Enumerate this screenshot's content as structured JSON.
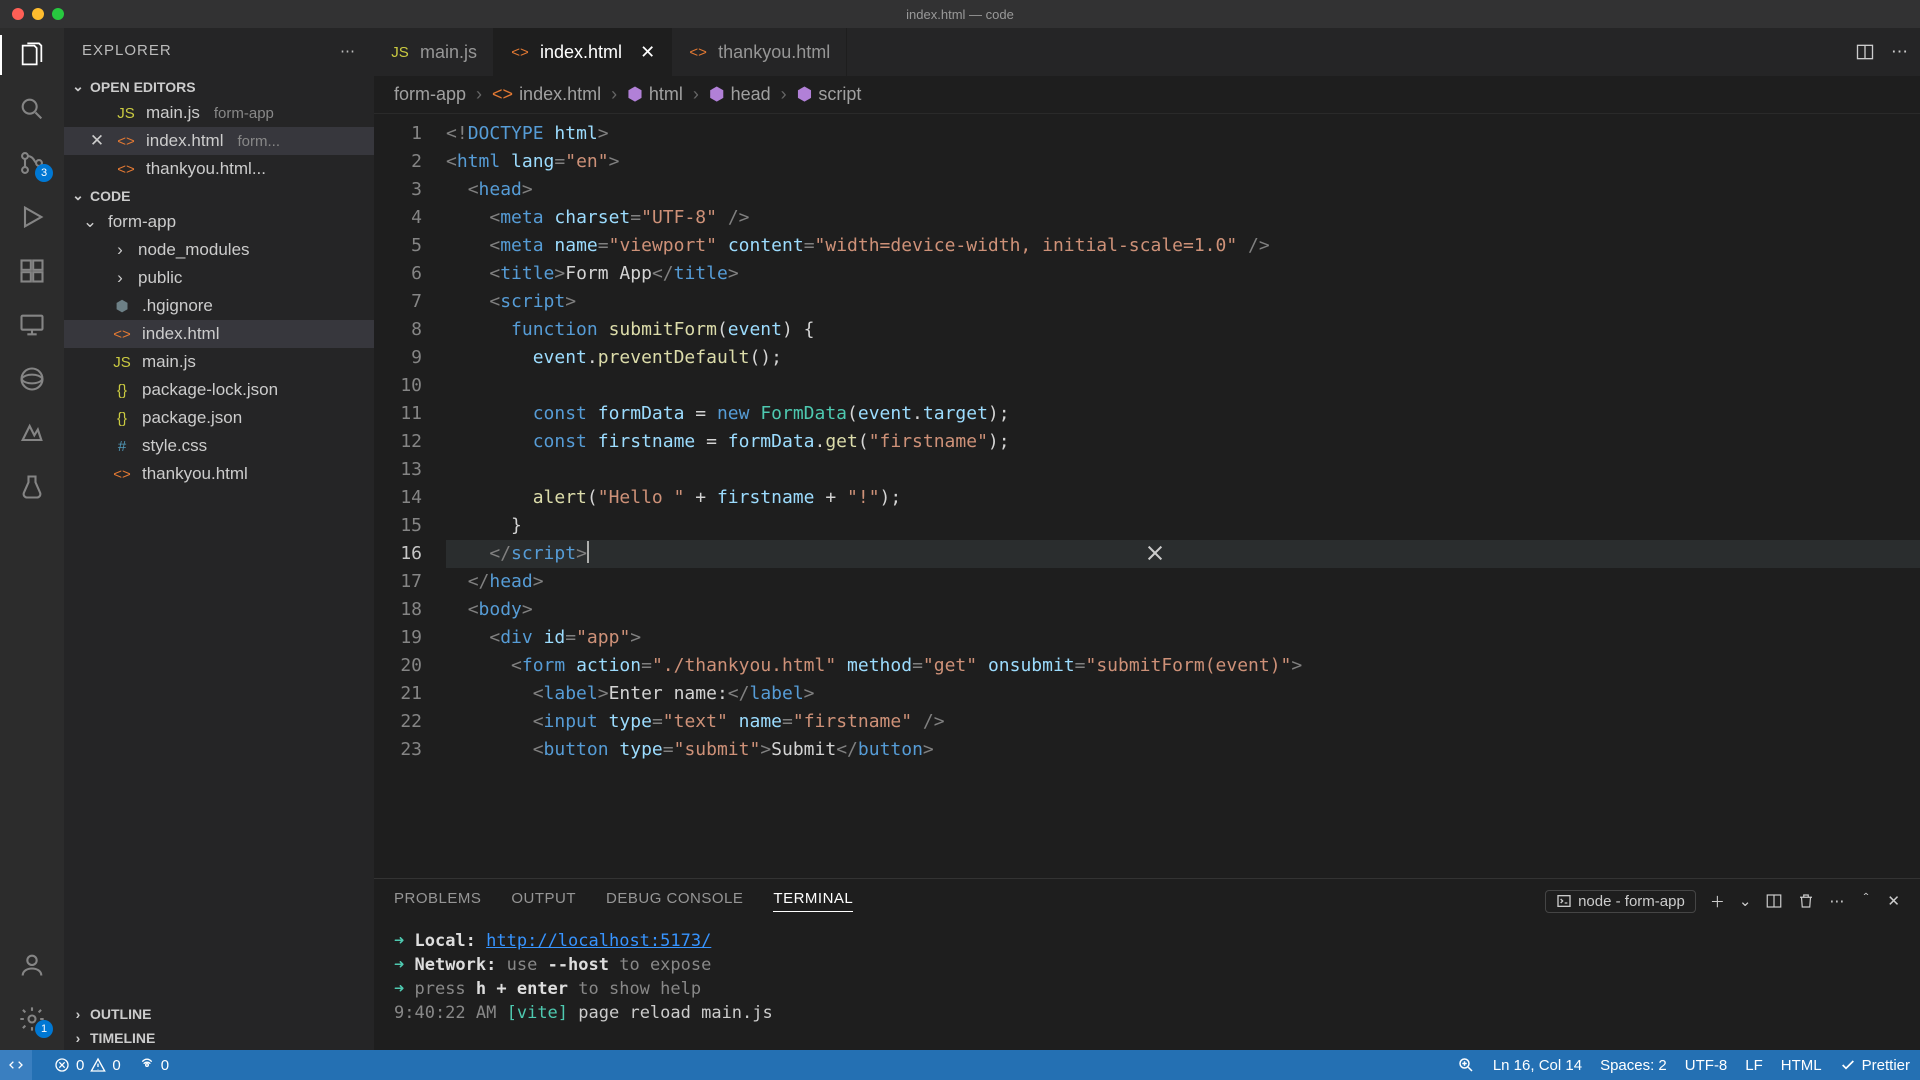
{
  "window": {
    "title": "index.html — code"
  },
  "activity_badges": {
    "sourceControl": "3",
    "settings": "1"
  },
  "sidebar": {
    "title": "EXPLORER",
    "openEditorsLabel": "OPEN EDITORS",
    "openEditors": [
      {
        "name": "main.js",
        "meta": "form-app",
        "icon": "JS",
        "iconColor": "#cbcb41"
      },
      {
        "name": "index.html",
        "meta": "form...",
        "icon": "<>",
        "iconColor": "#e37933",
        "active": true
      },
      {
        "name": "thankyou.html...",
        "meta": "",
        "icon": "<>",
        "iconColor": "#e37933"
      }
    ],
    "workspaceLabel": "CODE",
    "tree": {
      "root": "form-app",
      "items": [
        {
          "name": "node_modules",
          "type": "folder"
        },
        {
          "name": "public",
          "type": "folder"
        },
        {
          "name": ".hgignore",
          "type": "file",
          "icon": "⬢",
          "iconColor": "#6d8086"
        },
        {
          "name": "index.html",
          "type": "file",
          "icon": "<>",
          "iconColor": "#e37933",
          "selected": true
        },
        {
          "name": "main.js",
          "type": "file",
          "icon": "JS",
          "iconColor": "#cbcb41"
        },
        {
          "name": "package-lock.json",
          "type": "file",
          "icon": "{}",
          "iconColor": "#cbcb41"
        },
        {
          "name": "package.json",
          "type": "file",
          "icon": "{}",
          "iconColor": "#cbcb41"
        },
        {
          "name": "style.css",
          "type": "file",
          "icon": "#",
          "iconColor": "#519aba"
        },
        {
          "name": "thankyou.html",
          "type": "file",
          "icon": "<>",
          "iconColor": "#e37933"
        }
      ]
    },
    "outlineLabel": "OUTLINE",
    "timelineLabel": "TIMELINE"
  },
  "tabs": [
    {
      "name": "main.js",
      "icon": "JS",
      "iconColor": "#cbcb41"
    },
    {
      "name": "index.html",
      "icon": "<>",
      "iconColor": "#e37933",
      "active": true
    },
    {
      "name": "thankyou.html",
      "icon": "<>",
      "iconColor": "#e37933"
    }
  ],
  "breadcrumbs": [
    "form-app",
    "index.html",
    "html",
    "head",
    "script"
  ],
  "breadcrumb_icons": [
    "",
    "<>",
    "⬢",
    "⬢",
    "⬢"
  ],
  "cursor": {
    "line": 16,
    "col": 14
  },
  "code_lines": [
    [
      [
        "punc",
        "<!"
      ],
      [
        "tag",
        "DOCTYPE"
      ],
      [
        "plain",
        " "
      ],
      [
        "attr",
        "html"
      ],
      [
        "punc",
        ">"
      ]
    ],
    [
      [
        "punc",
        "<"
      ],
      [
        "tag",
        "html"
      ],
      [
        "plain",
        " "
      ],
      [
        "attr",
        "lang"
      ],
      [
        "punc",
        "="
      ],
      [
        "str",
        "\"en\""
      ],
      [
        "punc",
        ">"
      ]
    ],
    [
      [
        "plain",
        "  "
      ],
      [
        "punc",
        "<"
      ],
      [
        "tag",
        "head"
      ],
      [
        "punc",
        ">"
      ]
    ],
    [
      [
        "plain",
        "    "
      ],
      [
        "punc",
        "<"
      ],
      [
        "tag",
        "meta"
      ],
      [
        "plain",
        " "
      ],
      [
        "attr",
        "charset"
      ],
      [
        "punc",
        "="
      ],
      [
        "str",
        "\"UTF-8\""
      ],
      [
        "plain",
        " "
      ],
      [
        "punc",
        "/>"
      ]
    ],
    [
      [
        "plain",
        "    "
      ],
      [
        "punc",
        "<"
      ],
      [
        "tag",
        "meta"
      ],
      [
        "plain",
        " "
      ],
      [
        "attr",
        "name"
      ],
      [
        "punc",
        "="
      ],
      [
        "str",
        "\"viewport\""
      ],
      [
        "plain",
        " "
      ],
      [
        "attr",
        "content"
      ],
      [
        "punc",
        "="
      ],
      [
        "str",
        "\"width=device-width, initial-scale=1.0\""
      ],
      [
        "plain",
        " "
      ],
      [
        "punc",
        "/>"
      ]
    ],
    [
      [
        "plain",
        "    "
      ],
      [
        "punc",
        "<"
      ],
      [
        "tag",
        "title"
      ],
      [
        "punc",
        ">"
      ],
      [
        "plain",
        "Form App"
      ],
      [
        "punc",
        "</"
      ],
      [
        "tag",
        "title"
      ],
      [
        "punc",
        ">"
      ]
    ],
    [
      [
        "plain",
        "    "
      ],
      [
        "punc",
        "<"
      ],
      [
        "tag",
        "script"
      ],
      [
        "punc",
        ">"
      ]
    ],
    [
      [
        "plain",
        "      "
      ],
      [
        "kw",
        "function"
      ],
      [
        "plain",
        " "
      ],
      [
        "fn",
        "submitForm"
      ],
      [
        "plain",
        "("
      ],
      [
        "var",
        "event"
      ],
      [
        "plain",
        ") {"
      ]
    ],
    [
      [
        "plain",
        "        "
      ],
      [
        "var",
        "event"
      ],
      [
        "plain",
        "."
      ],
      [
        "fn",
        "preventDefault"
      ],
      [
        "plain",
        "();"
      ]
    ],
    [],
    [
      [
        "plain",
        "        "
      ],
      [
        "kw",
        "const"
      ],
      [
        "plain",
        " "
      ],
      [
        "var",
        "formData"
      ],
      [
        "plain",
        " = "
      ],
      [
        "kw",
        "new"
      ],
      [
        "plain",
        " "
      ],
      [
        "cls",
        "FormData"
      ],
      [
        "plain",
        "("
      ],
      [
        "var",
        "event"
      ],
      [
        "plain",
        "."
      ],
      [
        "var",
        "target"
      ],
      [
        "plain",
        ");"
      ]
    ],
    [
      [
        "plain",
        "        "
      ],
      [
        "kw",
        "const"
      ],
      [
        "plain",
        " "
      ],
      [
        "var",
        "firstname"
      ],
      [
        "plain",
        " = "
      ],
      [
        "var",
        "formData"
      ],
      [
        "plain",
        "."
      ],
      [
        "fn",
        "get"
      ],
      [
        "plain",
        "("
      ],
      [
        "str",
        "\"firstname\""
      ],
      [
        "plain",
        ");"
      ]
    ],
    [],
    [
      [
        "plain",
        "        "
      ],
      [
        "fn",
        "alert"
      ],
      [
        "plain",
        "("
      ],
      [
        "str",
        "\"Hello \""
      ],
      [
        "plain",
        " + "
      ],
      [
        "var",
        "firstname"
      ],
      [
        "plain",
        " + "
      ],
      [
        "str",
        "\"!\""
      ],
      [
        "plain",
        ");"
      ]
    ],
    [
      [
        "plain",
        "      }"
      ]
    ],
    [
      [
        "plain",
        "    "
      ],
      [
        "punc",
        "</"
      ],
      [
        "tag",
        "script"
      ],
      [
        "punc",
        ">"
      ]
    ],
    [
      [
        "plain",
        "  "
      ],
      [
        "punc",
        "</"
      ],
      [
        "tag",
        "head"
      ],
      [
        "punc",
        ">"
      ]
    ],
    [
      [
        "plain",
        "  "
      ],
      [
        "punc",
        "<"
      ],
      [
        "tag",
        "body"
      ],
      [
        "punc",
        ">"
      ]
    ],
    [
      [
        "plain",
        "    "
      ],
      [
        "punc",
        "<"
      ],
      [
        "tag",
        "div"
      ],
      [
        "plain",
        " "
      ],
      [
        "attr",
        "id"
      ],
      [
        "punc",
        "="
      ],
      [
        "str",
        "\"app\""
      ],
      [
        "punc",
        ">"
      ]
    ],
    [
      [
        "plain",
        "      "
      ],
      [
        "punc",
        "<"
      ],
      [
        "tag",
        "form"
      ],
      [
        "plain",
        " "
      ],
      [
        "attr",
        "action"
      ],
      [
        "punc",
        "="
      ],
      [
        "str",
        "\"./thankyou.html\""
      ],
      [
        "plain",
        " "
      ],
      [
        "attr",
        "method"
      ],
      [
        "punc",
        "="
      ],
      [
        "str",
        "\"get\""
      ],
      [
        "plain",
        " "
      ],
      [
        "attr",
        "onsubmit"
      ],
      [
        "punc",
        "="
      ],
      [
        "str",
        "\"submitForm(event)\""
      ],
      [
        "punc",
        ">"
      ]
    ],
    [
      [
        "plain",
        "        "
      ],
      [
        "punc",
        "<"
      ],
      [
        "tag",
        "label"
      ],
      [
        "punc",
        ">"
      ],
      [
        "plain",
        "Enter name:"
      ],
      [
        "punc",
        "</"
      ],
      [
        "tag",
        "label"
      ],
      [
        "punc",
        ">"
      ]
    ],
    [
      [
        "plain",
        "        "
      ],
      [
        "punc",
        "<"
      ],
      [
        "tag",
        "input"
      ],
      [
        "plain",
        " "
      ],
      [
        "attr",
        "type"
      ],
      [
        "punc",
        "="
      ],
      [
        "str",
        "\"text\""
      ],
      [
        "plain",
        " "
      ],
      [
        "attr",
        "name"
      ],
      [
        "punc",
        "="
      ],
      [
        "str",
        "\"firstname\""
      ],
      [
        "plain",
        " "
      ],
      [
        "punc",
        "/>"
      ]
    ],
    [
      [
        "plain",
        "        "
      ],
      [
        "punc",
        "<"
      ],
      [
        "tag",
        "button"
      ],
      [
        "plain",
        " "
      ],
      [
        "attr",
        "type"
      ],
      [
        "punc",
        "="
      ],
      [
        "str",
        "\"submit\""
      ],
      [
        "punc",
        ">"
      ],
      [
        "plain",
        "Submit"
      ],
      [
        "punc",
        "</"
      ],
      [
        "tag",
        "button"
      ],
      [
        "punc",
        ">"
      ]
    ]
  ],
  "panel": {
    "tabs": [
      "PROBLEMS",
      "OUTPUT",
      "DEBUG CONSOLE",
      "TERMINAL"
    ],
    "activeTab": 3,
    "terminalSelect": "node - form-app",
    "terminal": {
      "local_label": "Local:",
      "local_url": "http://localhost:5173/",
      "network_label": "Network:",
      "network_text": "use --host to expose",
      "help_text": "press h + enter to show help",
      "timestamp": "9:40:22 AM",
      "vite_tag": "[vite]",
      "reload_text": "page reload main.js"
    }
  },
  "status": {
    "errors": "0",
    "warnings": "0",
    "ports": "0",
    "lncol": "Ln 16, Col 14",
    "spaces": "Spaces: 2",
    "encoding": "UTF-8",
    "eol": "LF",
    "lang": "HTML",
    "formatter": "Prettier"
  }
}
